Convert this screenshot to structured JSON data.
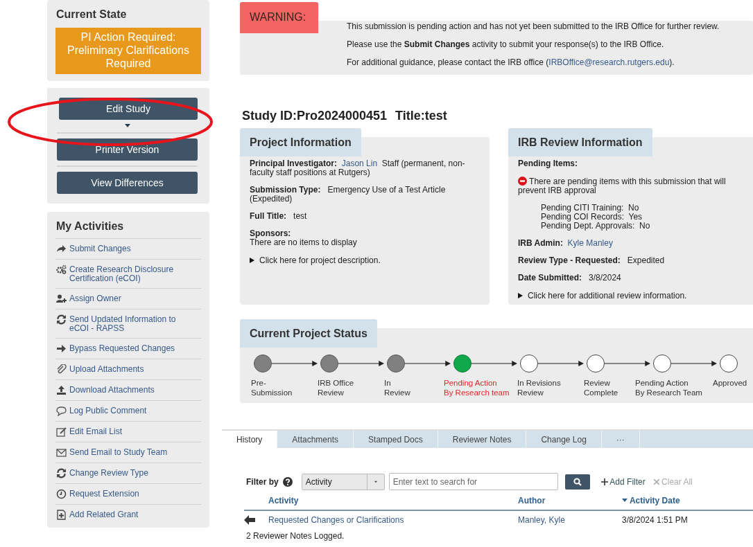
{
  "current_state": {
    "title": "Current State",
    "status": "PI Action Required: Preliminary Clarifications Required"
  },
  "actions": {
    "primary": "Edit Study",
    "buttons": [
      "Printer Version",
      "View Differences"
    ]
  },
  "activities": {
    "title": "My Activities",
    "items": [
      {
        "label": "Submit Changes"
      },
      {
        "label": "Create Research Disclosure Certification (eCOI)"
      },
      {
        "label": "Assign Owner"
      },
      {
        "label": "Send Updated Information to eCOI - RAPSS"
      },
      {
        "label": "Bypass Requested Changes"
      },
      {
        "label": "Upload Attachments"
      },
      {
        "label": "Download Attachments"
      },
      {
        "label": "Log Public Comment"
      },
      {
        "label": "Edit Email List"
      },
      {
        "label": "Send Email to Study Team"
      },
      {
        "label": "Change Review Type"
      },
      {
        "label": "Request Extension"
      },
      {
        "label": "Add Related Grant"
      }
    ]
  },
  "warning": {
    "label": "WARNING:",
    "lines": [
      {
        "text": "This submission is pending action and has not yet been submitted to the IRB Office for further review."
      },
      {
        "text": "Please use the **Submit Changes** activity to submit your response(s) to the IRB Office."
      },
      {
        "text": "For additional guidance, please contact the IRB office (",
        "link": "IRBOffice@research.rutgers.edu",
        "after": ")."
      }
    ]
  },
  "study": {
    "id": "Study ID:Pro2024000451",
    "title": "Title:test"
  },
  "project_information": {
    "title": "Project Information",
    "fields": [
      {
        "kind": "inline",
        "label": "Principal Investigator:",
        "link": "Jason Lin",
        "value": "Staff (permanent, non-faculty staff positions at Rutgers)"
      },
      {
        "kind": "inline",
        "label": "Submission Type:",
        "value": "Emergency Use of a Test Article (Expedited)"
      },
      {
        "kind": "inline",
        "label": "Full Title:",
        "value": "test"
      },
      {
        "kind": "stacked",
        "label": "Sponsors:",
        "value": "There are no items to display"
      }
    ],
    "disclosure": "Click here for project description."
  },
  "irb_review": {
    "title": "IRB Review Information",
    "pending_label": "Pending Items:",
    "alert": "There are pending items with this submission that will prevent IRB approval",
    "pending": [
      {
        "label": "Pending CITI Training:",
        "value": "No"
      },
      {
        "label": "Pending COI Records:",
        "value": "Yes"
      },
      {
        "label": "Pending Dept. Approvals:",
        "value": "No"
      }
    ],
    "fields": [
      {
        "kind": "inline",
        "label": "IRB Admin:",
        "link": "Kyle Manley"
      },
      {
        "kind": "inline",
        "label": "Review Type - Requested:",
        "value": "Expedited"
      },
      {
        "kind": "inline",
        "label": "Date Submitted:",
        "value": "3/8/2024"
      }
    ],
    "disclosure": "Click here for additional review information."
  },
  "project_status": {
    "title": "Current Project Status",
    "steps": [
      {
        "label": [
          "Pre-",
          "Submission"
        ],
        "completed": true,
        "current": false
      },
      {
        "label": [
          "IRB Office",
          "Review"
        ],
        "completed": true,
        "current": false
      },
      {
        "label": [
          "In",
          "Review"
        ],
        "completed": true,
        "current": false
      },
      {
        "label": [
          "Pending Action",
          "By Research team"
        ],
        "completed": false,
        "current": true
      },
      {
        "label": [
          "In Revisions",
          "Review"
        ],
        "completed": false,
        "current": false
      },
      {
        "label": [
          "Review",
          "Complete"
        ],
        "completed": false,
        "current": false
      },
      {
        "label": [
          "Pending Action",
          "By Research Team"
        ],
        "completed": false,
        "current": false
      },
      {
        "label": [
          "Approved"
        ],
        "completed": false,
        "current": false
      }
    ]
  },
  "tabs": [
    {
      "label": "History",
      "selected": true
    },
    {
      "label": "Attachments",
      "selected": false
    },
    {
      "label": "Stamped Docs",
      "selected": false
    },
    {
      "label": "Reviewer Notes",
      "selected": false
    },
    {
      "label": "Change Log",
      "selected": false
    },
    {
      "label": "···",
      "selected": false
    }
  ],
  "filter": {
    "label": "Filter by",
    "select": "Activity",
    "placeholder": "Enter text to search for",
    "add": "Add Filter",
    "clear": "Clear All",
    "clear_disabled": true
  },
  "history": {
    "columns": [
      {
        "label": "Activity",
        "sorted": false
      },
      {
        "label": "Author",
        "sorted": false
      },
      {
        "label": "Activity Date",
        "sorted": true
      }
    ],
    "rows": [
      {
        "activity": "Requested Changes or Clarifications",
        "author": "Manley, Kyle",
        "date": "3/8/2024 1:51 PM",
        "note": "2 Reviewer Notes Logged."
      }
    ]
  }
}
